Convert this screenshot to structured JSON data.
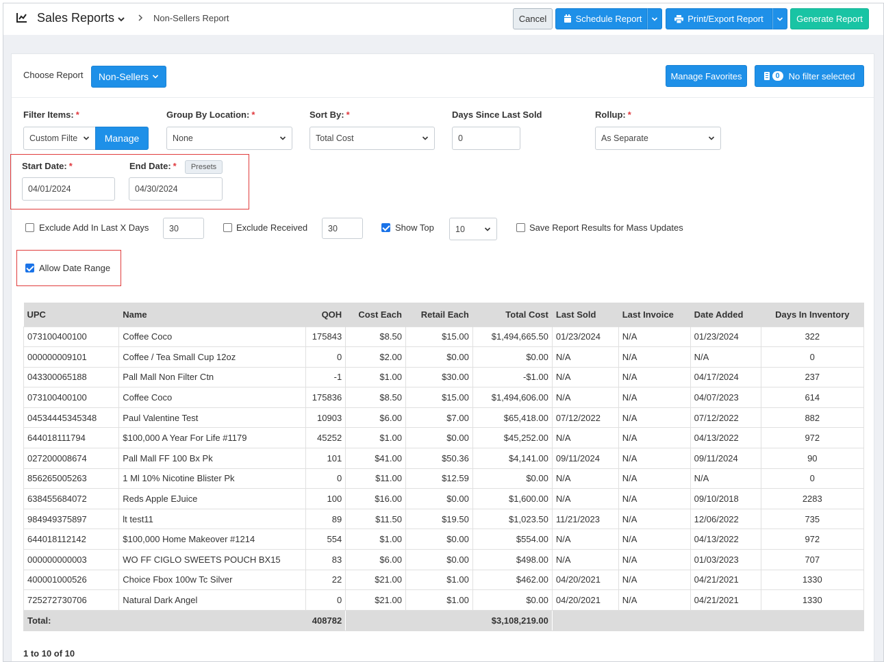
{
  "header": {
    "title": "Sales Reports",
    "breadcrumb": "Non-Sellers Report",
    "cancel": "Cancel",
    "schedule": "Schedule Report",
    "print": "Print/Export Report",
    "generate": "Generate Report"
  },
  "choose": {
    "label": "Choose Report",
    "report": "Non-Sellers",
    "favorites": "Manage Favorites",
    "filter_count": "0",
    "filter_text": "No filter selected"
  },
  "filters": {
    "filter_items": {
      "label": "Filter Items:",
      "value": "Custom Filte",
      "manage": "Manage"
    },
    "group_by": {
      "label": "Group By Location:",
      "value": "None"
    },
    "sort_by": {
      "label": "Sort By:",
      "value": "Total Cost"
    },
    "days_since": {
      "label": "Days Since Last Sold",
      "value": "0"
    },
    "rollup": {
      "label": "Rollup:",
      "value": "As Separate"
    },
    "start_date": {
      "label": "Start Date:",
      "value": "04/01/2024"
    },
    "end_date": {
      "label": "End Date:",
      "value": "04/30/2024"
    },
    "presets": "Presets"
  },
  "options": {
    "exclude_add": {
      "label": "Exclude Add In Last X Days",
      "value": "30",
      "checked": false
    },
    "exclude_received": {
      "label": "Exclude Received",
      "value": "30",
      "checked": false
    },
    "show_top": {
      "label": "Show Top",
      "value": "10",
      "checked": true
    },
    "save_results": {
      "label": "Save Report Results for Mass Updates",
      "checked": false
    },
    "allow_date_range": {
      "label": "Allow Date Range",
      "checked": true
    }
  },
  "table": {
    "columns": [
      "UPC",
      "Name",
      "QOH",
      "Cost Each",
      "Retail Each",
      "Total Cost",
      "Last Sold",
      "Last Invoice",
      "Date Added",
      "Days In Inventory"
    ],
    "rows": [
      [
        "073100400100",
        "Coffee Coco",
        "175843",
        "$8.50",
        "$15.00",
        "$1,494,665.50",
        "01/23/2024",
        "N/A",
        "01/23/2024",
        "322"
      ],
      [
        "000000009101",
        "Coffee / Tea Small Cup 12oz",
        "0",
        "$2.00",
        "$0.00",
        "$0.00",
        "N/A",
        "N/A",
        "N/A",
        "0"
      ],
      [
        "043300065188",
        "Pall Mall Non Filter Ctn",
        "-1",
        "$1.00",
        "$30.00",
        "-$1.00",
        "N/A",
        "N/A",
        "04/17/2024",
        "237"
      ],
      [
        "073100400100",
        "Coffee Coco",
        "175836",
        "$8.50",
        "$15.00",
        "$1,494,606.00",
        "N/A",
        "N/A",
        "04/07/2023",
        "614"
      ],
      [
        "04534445345348",
        "Paul Valentine Test",
        "10903",
        "$6.00",
        "$7.00",
        "$65,418.00",
        "07/12/2022",
        "N/A",
        "07/12/2022",
        "882"
      ],
      [
        "644018111794",
        "$100,000 A Year For Life #1179",
        "45252",
        "$1.00",
        "$0.00",
        "$45,252.00",
        "N/A",
        "N/A",
        "04/13/2022",
        "972"
      ],
      [
        "027200008674",
        "Pall Mall FF 100 Bx Pk",
        "101",
        "$41.00",
        "$50.36",
        "$4,141.00",
        "09/11/2024",
        "N/A",
        "09/11/2024",
        "90"
      ],
      [
        "856265005263",
        "1 Ml 10% Nicotine Blister Pk",
        "0",
        "$11.00",
        "$12.59",
        "$0.00",
        "N/A",
        "N/A",
        "N/A",
        "0"
      ],
      [
        "638455684072",
        "Reds Apple EJuice",
        "100",
        "$16.00",
        "$0.00",
        "$1,600.00",
        "N/A",
        "N/A",
        "09/10/2018",
        "2283"
      ],
      [
        "984949375897",
        "lt test11",
        "89",
        "$11.50",
        "$19.50",
        "$1,023.50",
        "11/21/2023",
        "N/A",
        "12/06/2022",
        "735"
      ],
      [
        "644018112142",
        "$100,000 Home Makeover #1214",
        "554",
        "$1.00",
        "$0.00",
        "$554.00",
        "N/A",
        "N/A",
        "04/13/2022",
        "972"
      ],
      [
        "000000000003",
        "WO FF CIGLO SWEETS POUCH BX15",
        "83",
        "$6.00",
        "$0.00",
        "$498.00",
        "N/A",
        "N/A",
        "01/03/2023",
        "707"
      ],
      [
        "400001000526",
        "Choice Fbox 100w Tc Silver",
        "22",
        "$21.00",
        "$1.00",
        "$462.00",
        "04/20/2021",
        "N/A",
        "04/21/2021",
        "1330"
      ],
      [
        "725272730706",
        "Natural Dark Angel",
        "0",
        "$21.00",
        "$1.00",
        "$0.00",
        "04/20/2021",
        "N/A",
        "04/21/2021",
        "1330"
      ]
    ],
    "total": {
      "label": "Total:",
      "qoh": "408782",
      "total_cost": "$3,108,219.00"
    }
  },
  "pager": "1 to 10 of 10",
  "icons": {
    "title": "chart-line-icon",
    "calendar": "calendar-icon",
    "print": "printer-icon",
    "filter": "filter-icon"
  },
  "colors": {
    "primary": "#1e90e8",
    "success": "#19c4a4",
    "highlight_box": "#e03b3b"
  }
}
